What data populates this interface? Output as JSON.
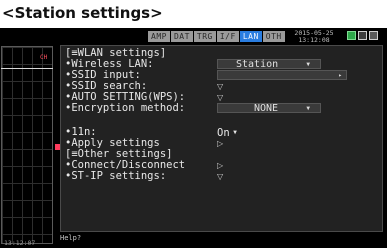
{
  "page_heading": "<Station settings>",
  "tabs": [
    {
      "label": "AMP",
      "active": false
    },
    {
      "label": "DAT",
      "active": false
    },
    {
      "label": "TRG",
      "active": false
    },
    {
      "label": "I/F",
      "active": false
    },
    {
      "label": "LAN",
      "active": true
    },
    {
      "label": "OTH",
      "active": false
    }
  ],
  "datetime": {
    "date": "2015-05-25",
    "time": "13:12:08"
  },
  "graph": {
    "channel_label": "CH",
    "clock": "13:12:07"
  },
  "sections": {
    "wlan": "[≡WLAN settings]",
    "other": "[≡Other settings]"
  },
  "rows": {
    "wireless_lan": {
      "label": "•Wireless LAN:",
      "value": "Station"
    },
    "ssid_input": {
      "label": "•SSID input:"
    },
    "ssid_search": {
      "label": "•SSID search:"
    },
    "auto_setting": {
      "label": "•AUTO SETTING(WPS):"
    },
    "encryption": {
      "label": "•Encryption method:",
      "value": "NONE"
    },
    "n11": {
      "label": "•11n:",
      "value": "On"
    },
    "apply": {
      "label": "•Apply settings"
    },
    "connect": {
      "label": "•Connect/Disconnect"
    },
    "st_ip": {
      "label": "•ST-IP settings:"
    }
  },
  "help_text": "Help?",
  "colors": {
    "active_tab": "#2a7de0",
    "marker": "#ff3b5c",
    "wifi_icon": "#2ea84a"
  }
}
